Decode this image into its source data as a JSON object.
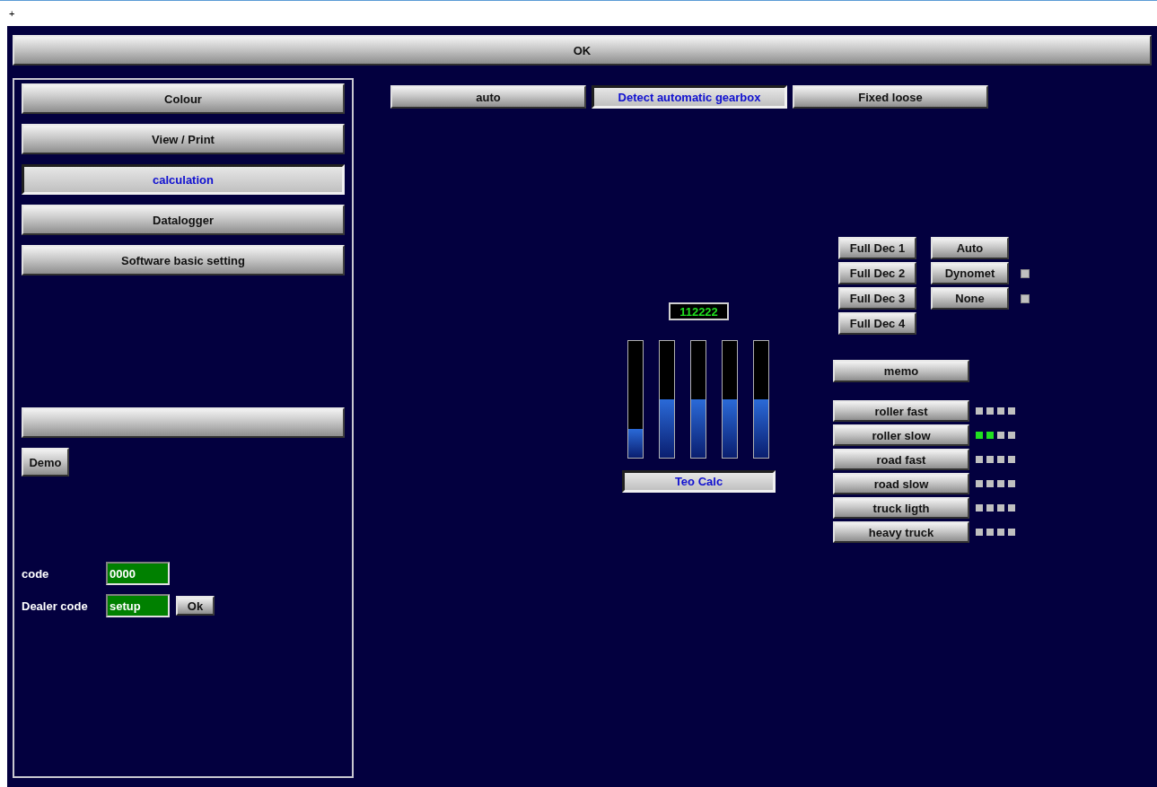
{
  "top_strip": {
    "label": "+"
  },
  "ok_button": {
    "label": "OK"
  },
  "menu": [
    {
      "label": "Colour",
      "selected": false
    },
    {
      "label": "View / Print",
      "selected": false
    },
    {
      "label": "calculation",
      "selected": true
    },
    {
      "label": "Datalogger",
      "selected": false
    },
    {
      "label": "Software basic setting",
      "selected": false
    }
  ],
  "demo_button": {
    "label": "Demo"
  },
  "code": {
    "label": "code",
    "value": "0000"
  },
  "dealer_code": {
    "label": "Dealer code",
    "value": "setup",
    "button": "Ok"
  },
  "tabs": [
    {
      "label": "auto",
      "selected": false
    },
    {
      "label": "Detect automatic gearbox",
      "selected": true
    },
    {
      "label": "Fixed loose",
      "selected": false
    }
  ],
  "readout": "112222",
  "bars": [
    {
      "level": 0.25
    },
    {
      "level": 0.5
    },
    {
      "level": 0.5
    },
    {
      "level": 0.5
    },
    {
      "level": 0.5
    }
  ],
  "teo_calc": {
    "label": "Teo Calc",
    "selected": true
  },
  "full_dec": [
    "Full Dec 1",
    "Full Dec 2",
    "Full Dec 3",
    "Full Dec 4"
  ],
  "brake_modes": [
    {
      "label": "Auto",
      "indicator": false
    },
    {
      "label": "Dynomet",
      "indicator": true
    },
    {
      "label": "None",
      "indicator": true
    }
  ],
  "memo": "memo",
  "modes": [
    {
      "label": "roller fast",
      "dots": [
        {
          "on": false
        },
        {
          "on": false
        },
        {
          "on": false
        },
        {
          "on": false
        }
      ]
    },
    {
      "label": "roller slow",
      "dots": [
        {
          "on": true
        },
        {
          "on": true
        },
        {
          "on": false
        },
        {
          "on": false
        }
      ]
    },
    {
      "label": "road fast",
      "dots": [
        {
          "on": false
        },
        {
          "on": false
        },
        {
          "on": false
        },
        {
          "on": false
        }
      ]
    },
    {
      "label": "road slow",
      "dots": [
        {
          "on": false
        },
        {
          "on": false
        },
        {
          "on": false
        },
        {
          "on": false
        }
      ]
    },
    {
      "label": "truck ligth",
      "dots": [
        {
          "on": false
        },
        {
          "on": false
        },
        {
          "on": false
        },
        {
          "on": false
        }
      ]
    },
    {
      "label": "heavy truck",
      "dots": [
        {
          "on": false
        },
        {
          "on": false
        },
        {
          "on": false
        },
        {
          "on": false
        }
      ]
    }
  ]
}
